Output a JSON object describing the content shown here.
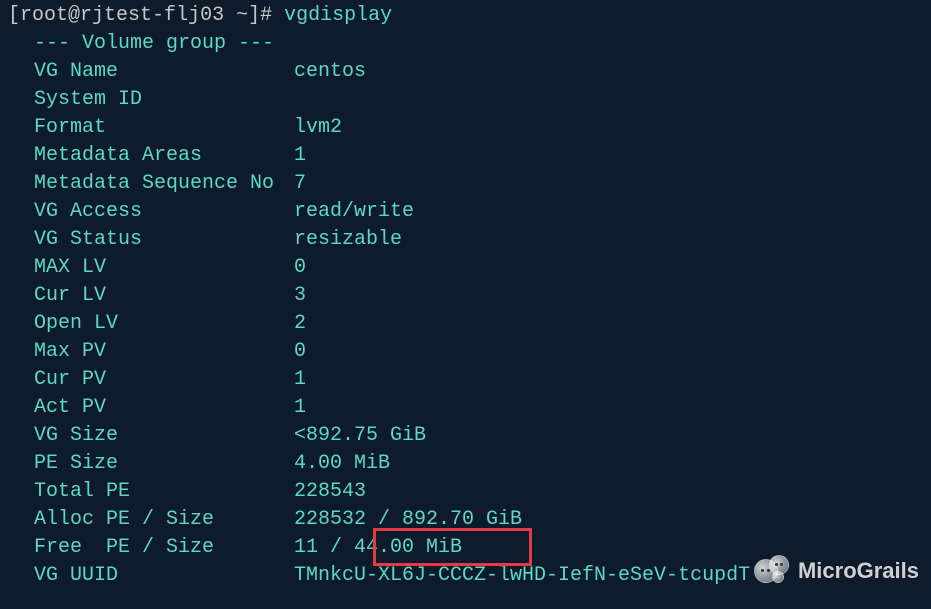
{
  "prompt": {
    "open": "[",
    "user": "root",
    "at": "@",
    "host": "rjtest-flj03",
    "path": " ~",
    "close": "]",
    "symbol": "# "
  },
  "command": "vgdisplay",
  "header": "--- Volume group ---",
  "rows": [
    {
      "label": "VG Name",
      "value": "centos"
    },
    {
      "label": "System ID",
      "value": ""
    },
    {
      "label": "Format",
      "value": "lvm2"
    },
    {
      "label": "Metadata Areas",
      "value": "1"
    },
    {
      "label": "Metadata Sequence No",
      "value": "7"
    },
    {
      "label": "VG Access",
      "value": "read/write"
    },
    {
      "label": "VG Status",
      "value": "resizable"
    },
    {
      "label": "MAX LV",
      "value": "0"
    },
    {
      "label": "Cur LV",
      "value": "3"
    },
    {
      "label": "Open LV",
      "value": "2"
    },
    {
      "label": "Max PV",
      "value": "0"
    },
    {
      "label": "Cur PV",
      "value": "1"
    },
    {
      "label": "Act PV",
      "value": "1"
    },
    {
      "label": "VG Size",
      "value": "<892.75 GiB"
    },
    {
      "label": "PE Size",
      "value": "4.00 MiB"
    },
    {
      "label": "Total PE",
      "value": "228543"
    },
    {
      "label": "Alloc PE / Size",
      "value": "228532 / 892.70 GiB"
    },
    {
      "label": "Free  PE / Size",
      "value": "11 / 44.00 MiB"
    },
    {
      "label": "VG UUID",
      "value": "TMnkcU-XL6J-CCCZ-lwHD-IefN-eSeV-tcupdT"
    }
  ],
  "watermark": "MicroGrails"
}
